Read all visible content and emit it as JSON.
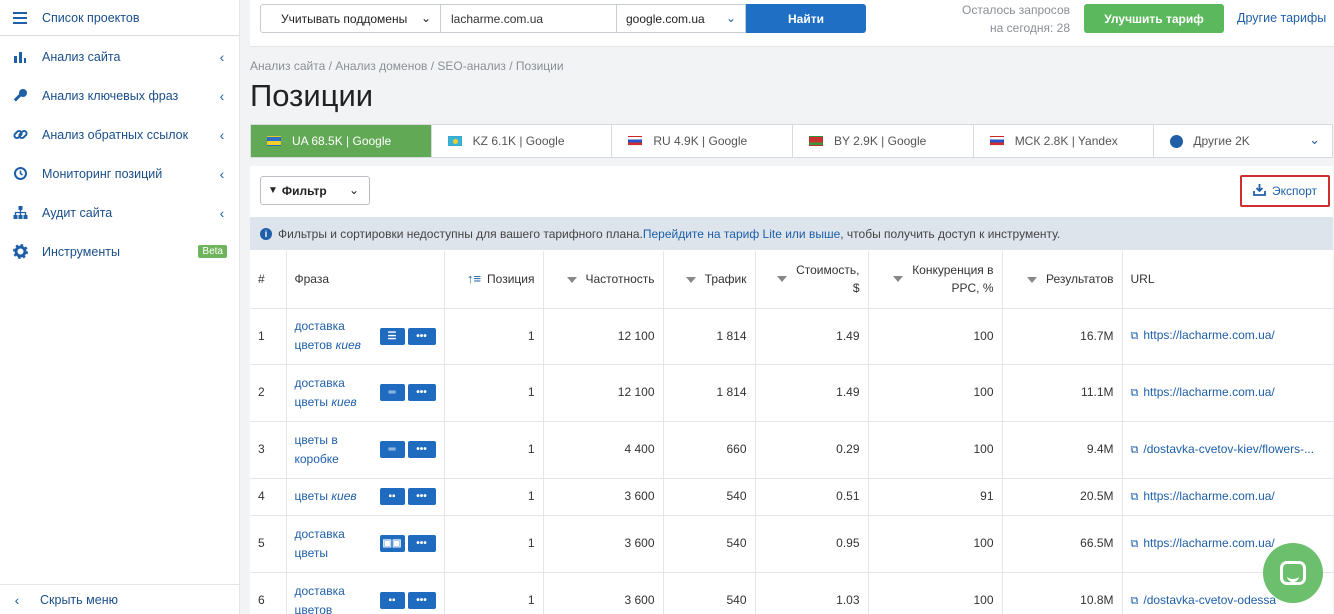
{
  "sidebar": {
    "top_label": "Список проектов",
    "items": [
      {
        "label": "Анализ сайта",
        "has_chevron": true
      },
      {
        "label": "Анализ ключевых фраз",
        "has_chevron": true
      },
      {
        "label": "Анализ обратных ссылок",
        "has_chevron": true
      },
      {
        "label": "Мониторинг позиций",
        "has_chevron": true
      },
      {
        "label": "Аудит сайта",
        "has_chevron": true
      },
      {
        "label": "Инструменты",
        "badge": "Beta"
      }
    ],
    "hide_menu": "Скрыть меню"
  },
  "topbar": {
    "subdomain_select": "Учитывать поддомены",
    "domain_value": "lacharme.com.ua",
    "engine_select": "google.com.ua",
    "find_button": "Найти",
    "remaining_line1": "Осталось запросов",
    "remaining_line2": "на сегодня: 28",
    "upgrade_button": "Улучшить тариф",
    "other_tariffs": "Другие тарифы"
  },
  "breadcrumb": "Анализ сайта / Анализ доменов / SEO-анализ / Позиции",
  "page_title": "Позиции",
  "region_tabs": [
    {
      "label": "UA 68.5K | Google",
      "flag": "ua",
      "active": true
    },
    {
      "label": "KZ 6.1K | Google",
      "flag": "kz"
    },
    {
      "label": "RU 4.9K | Google",
      "flag": "ru"
    },
    {
      "label": "BY 2.9K | Google",
      "flag": "by"
    },
    {
      "label": "МСК 2.8K | Yandex",
      "flag": "ru"
    },
    {
      "label": "Другие 2K",
      "flag": "globe"
    }
  ],
  "filter_button": "Фильтр",
  "export_button": "Экспорт",
  "notice": {
    "before": "Фильтры и сортировки недоступны для вашего тарифного плана. ",
    "link": "Перейдите на тариф Lite или выше",
    "after": ", чтобы получить доступ к инструменту."
  },
  "table": {
    "headers": {
      "num": "#",
      "phrase": "Фраза",
      "position": "Позиция",
      "frequency": "Частотность",
      "traffic": "Трафик",
      "cost_line1": "Стоимость,",
      "cost_line2": "$",
      "ppc_line1": "Конкуренция в",
      "ppc_line2": "PPC, %",
      "results": "Результатов",
      "url": "URL"
    },
    "rows": [
      {
        "num": "1",
        "phrase_plain": "доставка цветов",
        "phrase_italic": "киев",
        "position": "1",
        "frequency": "12 100",
        "traffic": "1 814",
        "cost": "1.49",
        "ppc": "100",
        "results": "16.7M",
        "url": "https://lacharme.com.ua/",
        "icons": [
          "menu-icon",
          "more-icon"
        ]
      },
      {
        "num": "2",
        "phrase_plain": "доставка цветы",
        "phrase_italic": "киев",
        "position": "1",
        "frequency": "12 100",
        "traffic": "1 814",
        "cost": "1.49",
        "ppc": "100",
        "results": "11.1M",
        "url": "https://lacharme.com.ua/",
        "icons": [
          "lines-icon",
          "more-icon"
        ]
      },
      {
        "num": "3",
        "phrase_plain": "цветы в коробке",
        "phrase_italic": "",
        "position": "1",
        "frequency": "4 400",
        "traffic": "660",
        "cost": "0.29",
        "ppc": "100",
        "results": "9.4M",
        "url": "/dostavka-cvetov-kiev/flowers-...",
        "icons": [
          "lines-icon",
          "more-icon"
        ]
      },
      {
        "num": "4",
        "phrase_plain": "цветы",
        "phrase_italic": "киев",
        "position": "1",
        "frequency": "3 600",
        "traffic": "540",
        "cost": "0.51",
        "ppc": "91",
        "results": "20.5M",
        "url": "https://lacharme.com.ua/",
        "icons": [
          "comment-icon",
          "more-icon"
        ]
      },
      {
        "num": "5",
        "phrase_plain": "доставка цветы",
        "phrase_italic": "",
        "position": "1",
        "frequency": "3 600",
        "traffic": "540",
        "cost": "0.95",
        "ppc": "100",
        "results": "66.5M",
        "url": "https://lacharme.com.ua/",
        "icons": [
          "images-icon",
          "more-icon"
        ]
      },
      {
        "num": "6",
        "phrase_plain": "доставка цветов",
        "phrase_italic": "",
        "position": "1",
        "frequency": "3 600",
        "traffic": "540",
        "cost": "1.03",
        "ppc": "100",
        "results": "10.8M",
        "url": "/dostavka-cvetov-odessa",
        "icons": [
          "comment-icon",
          "more-icon"
        ]
      }
    ]
  },
  "colors": {
    "accent": "#1f6fc5",
    "active_tab": "#62a956",
    "upgrade": "#5cb85c",
    "export_outline": "#d02e2e"
  }
}
